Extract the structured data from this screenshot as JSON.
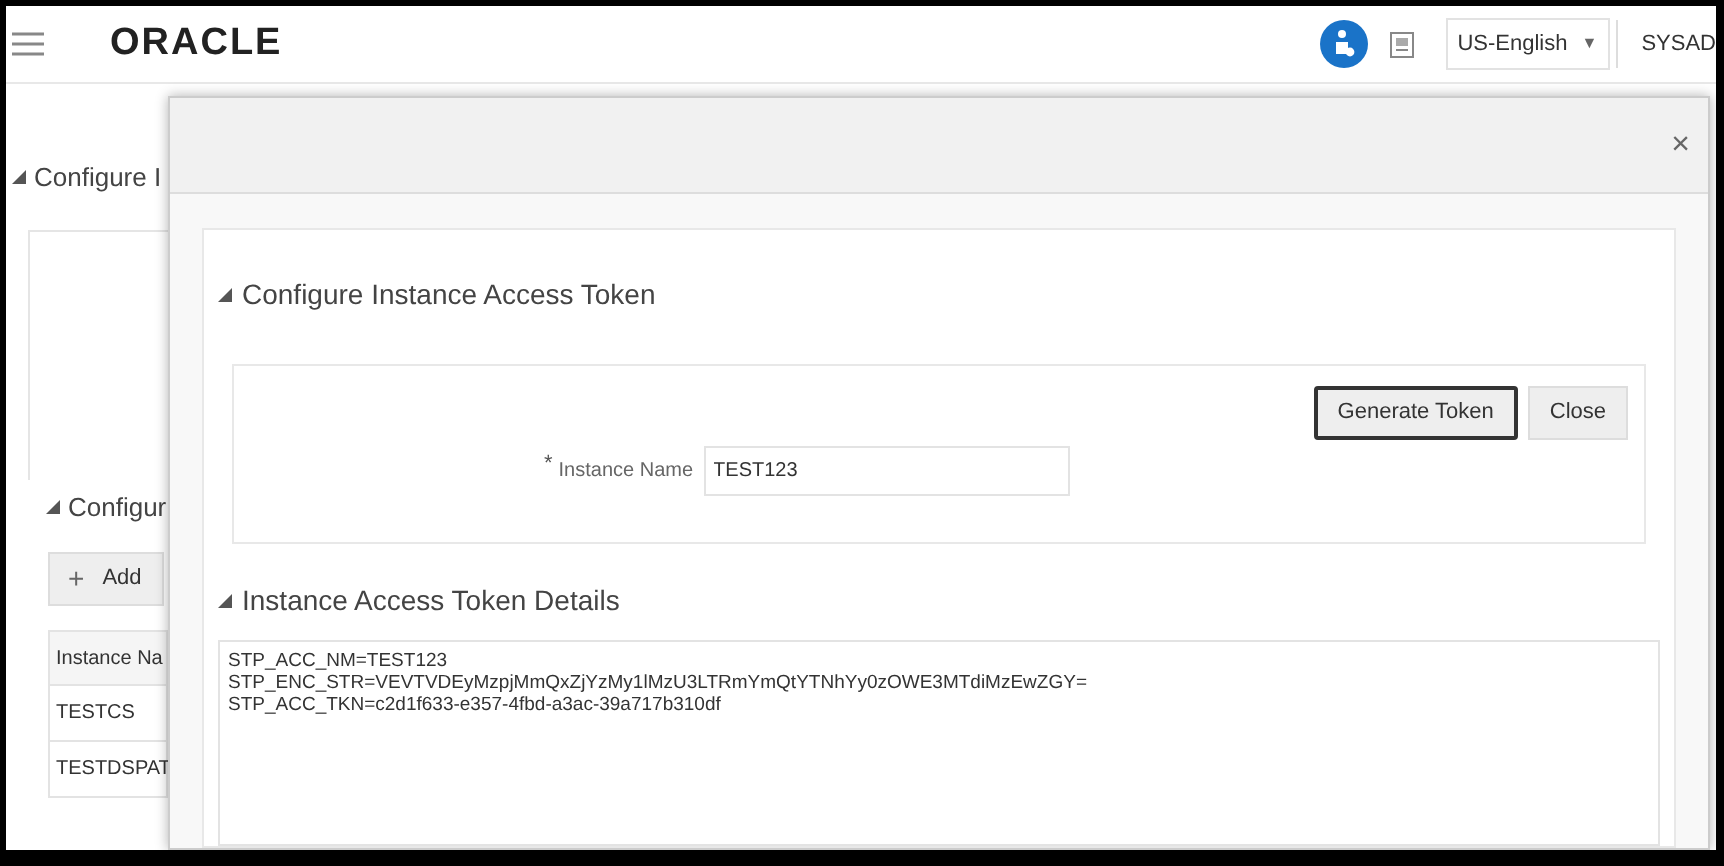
{
  "header": {
    "logo": "ORACLE",
    "language": "US-English",
    "caret": "▼",
    "user": "SYSAD"
  },
  "background": {
    "section_1_title": "Configure I",
    "section_2_title": "Configur",
    "add_icon": "+",
    "add_button": "Add",
    "table": {
      "column_1": "Instance Na",
      "rows": [
        "TESTCS",
        "TESTDSPAT"
      ]
    }
  },
  "dialog": {
    "close_icon": "×",
    "section_title": "Configure Instance Access Token",
    "buttons": [
      "Generate Token",
      "Close"
    ],
    "instance_name": {
      "required_mark": "*",
      "label": "Instance Name",
      "value": "TEST123"
    },
    "details_title": "Instance Access Token Details",
    "token_lines": [
      "STP_ACC_NM=TEST123",
      "STP_ENC_STR=VEVTVDEyMzpjMmQxZjYzMy1lMzU3LTRmYmQtYTNhYy0zOWE3MTdiMzEwZGY=",
      "STP_ACC_TKN=c2d1f633-e357-4fbd-a3ac-39a717b310df"
    ]
  }
}
